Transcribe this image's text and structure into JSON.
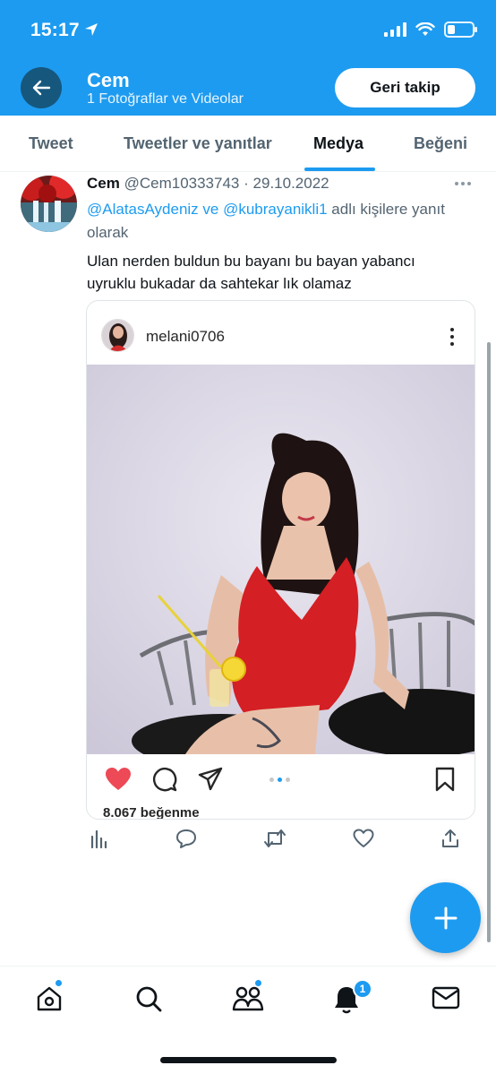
{
  "status_bar": {
    "time": "15:17"
  },
  "header": {
    "name": "Cem",
    "subtitle": "1 Fotoğraflar ve Videolar",
    "follow_button": "Geri takip",
    "color": "#1d9bf0"
  },
  "tabs": [
    {
      "label": "Tweet",
      "active": false
    },
    {
      "label": "Tweetler ve yanıtlar",
      "active": false
    },
    {
      "label": "Medya",
      "active": true
    },
    {
      "label": "Beğeni",
      "active": false
    }
  ],
  "tweet": {
    "author": "Cem",
    "handle": "@Cem10333743",
    "separator": "·",
    "date": "29.10.2022",
    "reply_mention_1": "@AlatasAydeniz",
    "reply_and": " ve ",
    "reply_mention_2": "@kubrayanikli1",
    "reply_suffix": " adlı kişilere yanıt olarak",
    "text": "Ulan nerden buldun bu bayanı bu bayan yabancı uyruklu bukadar da sahtekar lık olamaz"
  },
  "embedded_post": {
    "username": "melani0706",
    "likes": "8.067 beğenme",
    "carousel_active_index": 1,
    "carousel_count": 3
  },
  "icons": {
    "back": "arrow-left-icon",
    "more": "more-horizontal-icon",
    "tweet_actions": [
      "analytics-icon",
      "reply-icon",
      "retweet-icon",
      "like-icon",
      "share-icon"
    ],
    "ig_actions": [
      "heart-icon",
      "comment-icon",
      "send-icon",
      "bookmark-icon"
    ],
    "nav": [
      "home-icon",
      "search-icon",
      "communities-icon",
      "notifications-icon",
      "messages-icon"
    ]
  },
  "bottom_nav": {
    "notification_badge": "1"
  },
  "colors": {
    "accent": "#1d9bf0",
    "heart": "#ed4956",
    "text": "#0f1419",
    "muted": "#536471"
  }
}
